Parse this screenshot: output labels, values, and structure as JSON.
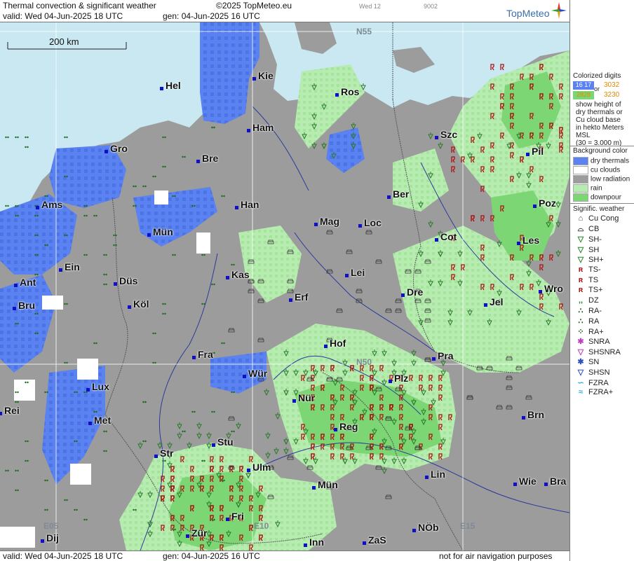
{
  "header": {
    "title": "Thermal convection & significant weather",
    "copyright": "©2025 TopMeteo.eu",
    "day": "Wed 12",
    "code": "9002",
    "valid": "valid:  Wed  04-Jun-2025  18 UTC",
    "gen": "gen: 04-Jun-2025 16 UTC",
    "brand": "TopMeteo"
  },
  "footer": {
    "valid": "valid:  Wed  04-Jun-2025  18 UTC",
    "gen": "gen: 04-Jun-2025 16 UTC",
    "notice": "not for air navigation purposes"
  },
  "map": {
    "scale_label": "200 km",
    "grid_labels": [
      "N55",
      "N50",
      "E05",
      "E10",
      "E15"
    ],
    "cities": [
      "Hel",
      "Kie",
      "Ros",
      "Ham",
      "Szc",
      "Gro",
      "Bre",
      "Pil",
      "Ber",
      "Ams",
      "Han",
      "Poz",
      "Mag",
      "Loc",
      "Mün",
      "Cot",
      "Les",
      "Ein",
      "Kas",
      "Lei",
      "Ant",
      "Düs",
      "Bru",
      "Köl",
      "Erf",
      "Dre",
      "Wro",
      "Jel",
      "Hof",
      "Fra",
      "Pra",
      "Lux",
      "Wür",
      "Plz",
      "Rei",
      "Nür",
      "Met",
      "Brn",
      "Reg",
      "Str",
      "Stu",
      "Lin",
      "Ulm",
      "Wie",
      "Bra",
      "Mün",
      "Fri",
      "Dij",
      "Zür",
      "Inn",
      "ZaS",
      "NÖb"
    ]
  },
  "legend": {
    "colorized_title": "Colorized digits",
    "sample_digits": [
      "16 17",
      "3032",
      "or",
      "2828",
      "3230"
    ],
    "explain": [
      "show height of",
      "dry thermals or",
      "Cu cloud base",
      "in hekto Meters",
      "MSL",
      "(30 = 3.000 m)"
    ],
    "bg_title": "Background color",
    "bg_items": [
      {
        "label": "dry thermals",
        "color": "#5a82f0"
      },
      {
        "label": "cu clouds",
        "color": "#ffffff"
      },
      {
        "label": "low radiation",
        "color": "#9c9c9c"
      },
      {
        "label": "rain",
        "color": "#b7ecb0"
      },
      {
        "label": "downpour",
        "color": "#7bd673"
      }
    ],
    "wx_title": "Signific. weather",
    "wx_items": [
      "Cu Cong",
      "CB",
      "SH-",
      "SH",
      "SH+",
      "TS-",
      "TS",
      "TS+",
      "DZ",
      "RA-",
      "RA",
      "RA+",
      "SNRA",
      "SHSNRA",
      "SN",
      "SHSN",
      "FZRA",
      "FZRA+"
    ],
    "wx_icons": [
      "cu-cong-icon",
      "cb-icon",
      "shower-light-icon",
      "shower-icon",
      "shower-heavy-icon",
      "thunderstorm-light-icon",
      "thunderstorm-icon",
      "thunderstorm-heavy-icon",
      "drizzle-icon",
      "rain-light-icon",
      "rain-icon",
      "rain-heavy-icon",
      "snow-rain-icon",
      "snow-rain-shower-icon",
      "snow-icon",
      "snow-shower-icon",
      "freezing-rain-icon",
      "freezing-rain-heavy-icon"
    ],
    "wx_colors": [
      "#444",
      "#444",
      "#2a8a2a",
      "#2a8a2a",
      "#2a8a2a",
      "#b01010",
      "#b01010",
      "#b01010",
      "#1a7a1a",
      "#1a5a1a",
      "#1a5a1a",
      "#1a5a1a",
      "#c040c0",
      "#c040c0",
      "#3050c0",
      "#3050c0",
      "#30b0e0",
      "#30b0e0"
    ]
  },
  "colors": {
    "sea": "#c9e8f2",
    "land": "#9c9c9c",
    "dry_thermals": "#5a82f0",
    "rain": "#b7ecb0",
    "downpour": "#7bd673"
  }
}
